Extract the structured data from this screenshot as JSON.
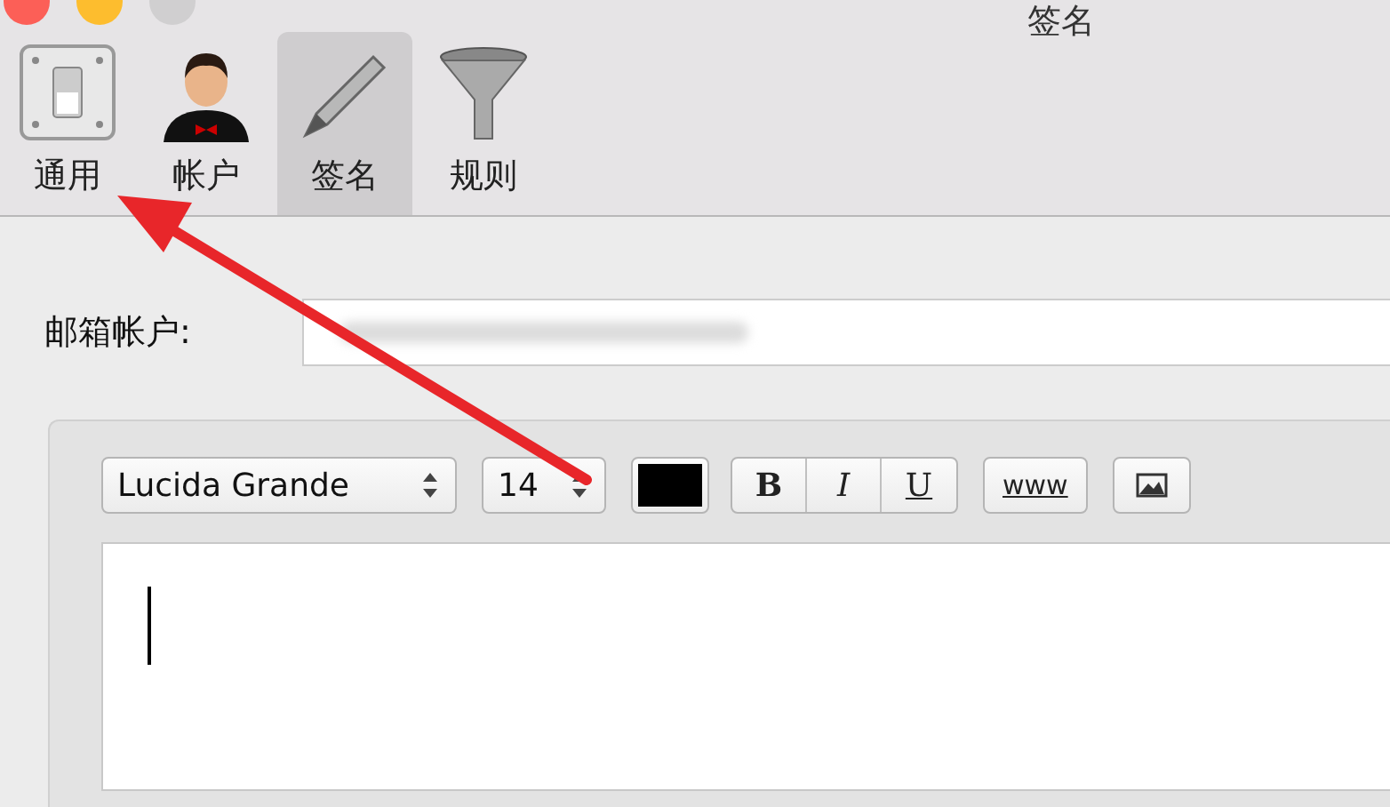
{
  "window": {
    "title": "签名"
  },
  "toolbar": [
    {
      "label": "通用",
      "kind": "switch",
      "selected": false
    },
    {
      "label": "帐户",
      "kind": "person",
      "selected": false
    },
    {
      "label": "签名",
      "kind": "pen",
      "selected": true
    },
    {
      "label": "规则",
      "kind": "funnel",
      "selected": false
    }
  ],
  "account": {
    "label": "邮箱帐户:"
  },
  "format_bar": {
    "font": "Lucida Grande",
    "size": "14",
    "styles": [
      {
        "label": "B",
        "kind": "bold"
      },
      {
        "label": "I",
        "kind": "italic"
      },
      {
        "label": "U",
        "kind": "underline"
      }
    ],
    "link": "www"
  }
}
